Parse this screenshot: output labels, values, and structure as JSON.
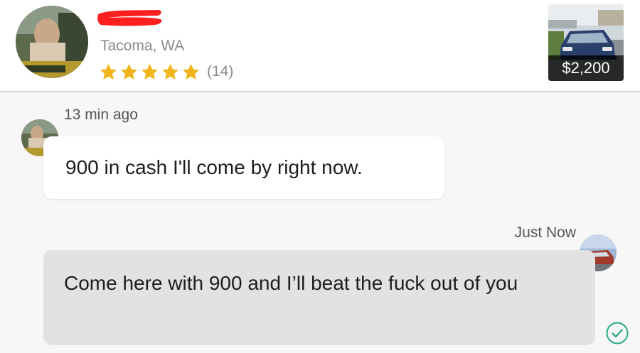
{
  "header": {
    "seller_location": "Tacoma, WA",
    "rating": {
      "stars": 5,
      "max_stars": 5,
      "count_label": "(14)"
    },
    "listing": {
      "price": "$2,200"
    }
  },
  "messages": [
    {
      "sender": "buyer",
      "timestamp": "13 min ago",
      "text": "900 in cash I'll come by right now."
    },
    {
      "sender": "seller",
      "timestamp": "Just Now",
      "text": "Come here with 900 and I’ll beat the fuck out of you",
      "status": "read"
    }
  ],
  "icons": {
    "star": "star-icon",
    "read_receipt": "checkmark-circle-icon"
  },
  "colors": {
    "star": "#f2b41c",
    "check": "#2aaa8a",
    "redaction": "#ff1f1f",
    "muted_text": "#8a8a8a",
    "outgoing_bubble": "#e2e2e2",
    "incoming_bubble": "#ffffff"
  }
}
